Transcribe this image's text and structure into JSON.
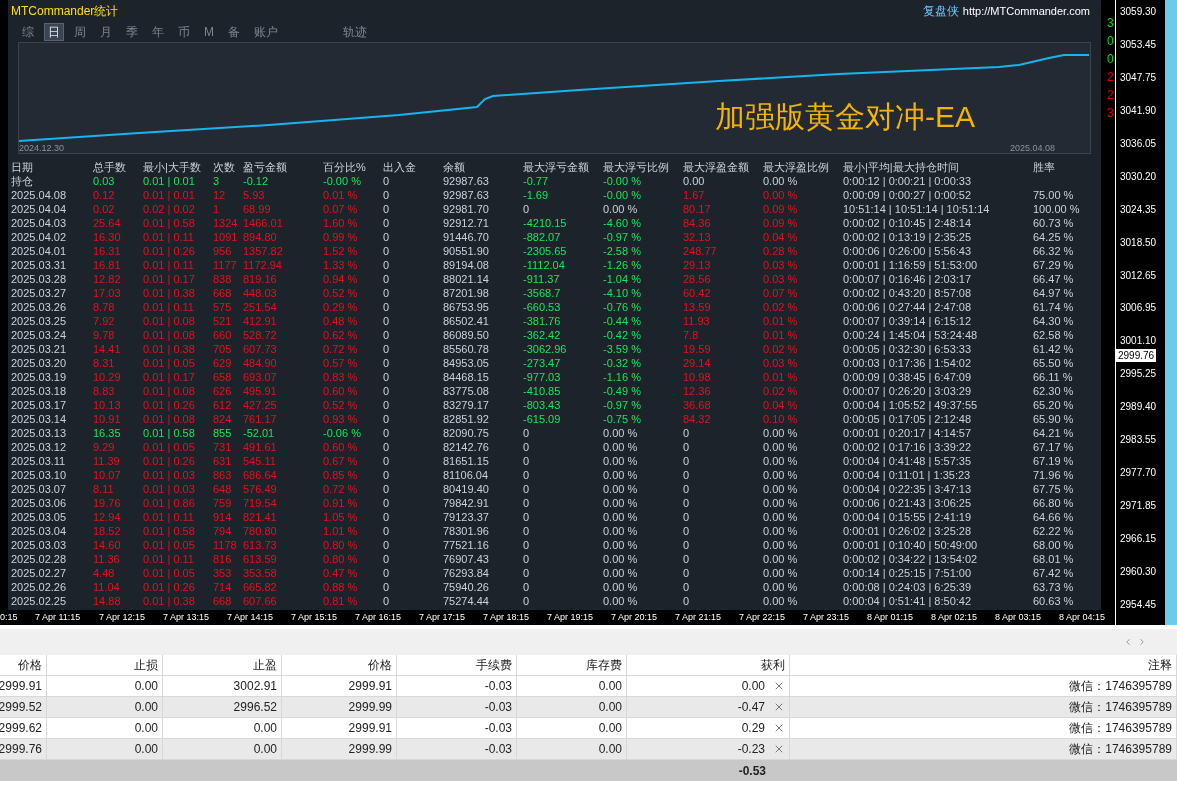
{
  "panel": {
    "title": "MTCommander统计",
    "brand": "复盘侠",
    "link": "http://MTCommander.com",
    "tabs": [
      {
        "label": "综",
        "selected": false
      },
      {
        "label": "日",
        "selected": true
      },
      {
        "label": "周",
        "selected": false
      },
      {
        "label": "月",
        "selected": false
      },
      {
        "label": "季",
        "selected": false
      },
      {
        "label": "年",
        "selected": false
      },
      {
        "label": "币",
        "selected": false
      },
      {
        "label": "M",
        "selected": false
      },
      {
        "label": "备",
        "selected": false
      },
      {
        "label": "账户",
        "selected": false
      }
    ],
    "trail_tab": {
      "label": "轨迹",
      "selected": false
    },
    "equity_chart": {
      "heading": "加强版黄金对冲-EA",
      "start_date": "2024.12.30",
      "end_date": "2025.04.08"
    },
    "stats_table": {
      "columns": [
        "日期",
        "总手数",
        "最小|大手数",
        "次数",
        "盈亏金额",
        "百分比%",
        "出入金",
        "余额",
        "最大浮亏金额",
        "最大浮亏比例",
        "最大浮盈金额",
        "最大浮盈比例",
        "最小|平均|最大持仓时间",
        "胜率"
      ],
      "rows": [
        {
          "profitable": false,
          "loss_marked": true,
          "gain_marked": false,
          "cells": [
            "持仓",
            "0.03",
            "0.01 | 0.01",
            "3",
            "-0.12",
            "-0.00 %",
            "0",
            "92987.63",
            "-0.77",
            "-0.00 %",
            "0.00",
            "0.00 %",
            "0:00:12 | 0:00:21 | 0:00:33"
          ]
        },
        {
          "profitable": true,
          "loss_marked": true,
          "gain_marked": true,
          "cells": [
            "2025.04.08",
            "0.12",
            "0.01 | 0.01",
            "12",
            "5.93",
            "0.01 %",
            "0",
            "92987.63",
            "-1.69",
            "-0.00 %",
            "1.67",
            "0.00 %",
            "0:00:09 | 0:00:27 | 0:00:52",
            "75.00 %"
          ]
        },
        {
          "profitable": true,
          "loss_marked": false,
          "gain_marked": true,
          "cells": [
            "2025.04.04",
            "0.02",
            "0.02 | 0.02",
            "1",
            "68.99",
            "0.07 %",
            "0",
            "92981.70",
            "0",
            "0.00 %",
            "80.17",
            "0.09 %",
            "10:51:14 | 10:51:14 | 10:51:14",
            "100.00 %"
          ]
        },
        {
          "profitable": true,
          "loss_marked": true,
          "gain_marked": true,
          "cells": [
            "2025.04.03",
            "25.64",
            "0.01 | 0.58",
            "1324",
            "1466.01",
            "1.60 %",
            "0",
            "92912.71",
            "-4210.15",
            "-4.60 %",
            "84.36",
            "0.09 %",
            "0:00:02 | 0:10:45 | 2:48:14",
            "60.73 %"
          ]
        },
        {
          "profitable": true,
          "loss_marked": true,
          "gain_marked": true,
          "cells": [
            "2025.04.02",
            "16.30",
            "0.01 | 0.11",
            "1091",
            "894.80",
            "0.99 %",
            "0",
            "91446.70",
            "-882.07",
            "-0.97 %",
            "32.13",
            "0.04 %",
            "0:00:02 | 0:13:19 | 2:35:25",
            "64.25 %"
          ]
        },
        {
          "profitable": true,
          "loss_marked": true,
          "gain_marked": true,
          "cells": [
            "2025.04.01",
            "16.31",
            "0.01 | 0.26",
            "956",
            "1357.82",
            "1.52 %",
            "0",
            "90551.90",
            "-2305.65",
            "-2.58 %",
            "248.77",
            "0.28 %",
            "0:00:06 | 0:26:00 | 5:56:43",
            "66.32 %"
          ]
        },
        {
          "profitable": true,
          "loss_marked": true,
          "gain_marked": true,
          "cells": [
            "2025.03.31",
            "16.81",
            "0.01 | 0.11",
            "1177",
            "1172.94",
            "1.33 %",
            "0",
            "89194.08",
            "-1112.04",
            "-1.26 %",
            "29.13",
            "0.03 %",
            "0:00:01 | 1:16:59 | 51:53:00",
            "67.29 %"
          ]
        },
        {
          "profitable": true,
          "loss_marked": true,
          "gain_marked": true,
          "cells": [
            "2025.03.28",
            "12.82",
            "0.01 | 0.17",
            "838",
            "819.16",
            "0.94 %",
            "0",
            "88021.14",
            "-911.37",
            "-1.04 %",
            "28.56",
            "0.03 %",
            "0:00:07 | 0:16:46 | 2:03:17",
            "66.47 %"
          ]
        },
        {
          "profitable": true,
          "loss_marked": true,
          "gain_marked": true,
          "cells": [
            "2025.03.27",
            "17.03",
            "0.01 | 0.38",
            "668",
            "448.03",
            "0.52 %",
            "0",
            "87201.98",
            "-3568.7",
            "-4.10 %",
            "60.42",
            "0.07 %",
            "0:00:02 | 0:43:20 | 8:57:08",
            "64.97 %"
          ]
        },
        {
          "profitable": true,
          "loss_marked": true,
          "gain_marked": true,
          "cells": [
            "2025.03.26",
            "8.78",
            "0.01 | 0.11",
            "575",
            "251.54",
            "0.29 %",
            "0",
            "86753.95",
            "-660.53",
            "-0.76 %",
            "13.59",
            "0.02 %",
            "0:00:06 | 0:27:44 | 2:47:08",
            "61.74 %"
          ]
        },
        {
          "profitable": true,
          "loss_marked": true,
          "gain_marked": true,
          "cells": [
            "2025.03.25",
            "7.92",
            "0.01 | 0.08",
            "521",
            "412.91",
            "0.48 %",
            "0",
            "86502.41",
            "-381.76",
            "-0.44 %",
            "11.93",
            "0.01 %",
            "0:00:07 | 0:39:14 | 6:15:12",
            "64.30 %"
          ]
        },
        {
          "profitable": true,
          "loss_marked": true,
          "gain_marked": true,
          "cells": [
            "2025.03.24",
            "9.78",
            "0.01 | 0.08",
            "660",
            "528.72",
            "0.62 %",
            "0",
            "86089.50",
            "-362.42",
            "-0.42 %",
            "7.8",
            "0.01 %",
            "0:00:24 | 1:45:04 | 53:24:48",
            "62.58 %"
          ]
        },
        {
          "profitable": true,
          "loss_marked": true,
          "gain_marked": true,
          "cells": [
            "2025.03.21",
            "14.41",
            "0.01 | 0.38",
            "705",
            "607.73",
            "0.72 %",
            "0",
            "85560.78",
            "-3062.96",
            "-3.59 %",
            "19.59",
            "0.02 %",
            "0:00:05 | 0:32:30 | 6:53:33",
            "61.42 %"
          ]
        },
        {
          "profitable": true,
          "loss_marked": true,
          "gain_marked": true,
          "cells": [
            "2025.03.20",
            "8.31",
            "0.01 | 0.05",
            "629",
            "484.90",
            "0.57 %",
            "0",
            "84953.05",
            "-273.47",
            "-0.32 %",
            "29.14",
            "0.03 %",
            "0:00:03 | 0:17:36 | 1:54:02",
            "65.50 %"
          ]
        },
        {
          "profitable": true,
          "loss_marked": true,
          "gain_marked": true,
          "cells": [
            "2025.03.19",
            "10.29",
            "0.01 | 0.17",
            "658",
            "693.07",
            "0.83 %",
            "0",
            "84468.15",
            "-977.03",
            "-1.16 %",
            "10.98",
            "0.01 %",
            "0:00:09 | 0:38:45 | 6:47:09",
            "66.11 %"
          ]
        },
        {
          "profitable": true,
          "loss_marked": true,
          "gain_marked": true,
          "cells": [
            "2025.03.18",
            "8.83",
            "0.01 | 0.08",
            "626",
            "495.91",
            "0.60 %",
            "0",
            "83775.08",
            "-410.85",
            "-0.49 %",
            "12.36",
            "0.02 %",
            "0:00:07 | 0:26:20 | 3:03:29",
            "62.30 %"
          ]
        },
        {
          "profitable": true,
          "loss_marked": true,
          "gain_marked": true,
          "cells": [
            "2025.03.17",
            "10.13",
            "0.01 | 0.26",
            "612",
            "427.25",
            "0.52 %",
            "0",
            "83279.17",
            "-803.43",
            "-0.97 %",
            "36.68",
            "0.04 %",
            "0:00:04 | 1:05:52 | 49:37:55",
            "65.20 %"
          ]
        },
        {
          "profitable": true,
          "loss_marked": true,
          "gain_marked": true,
          "cells": [
            "2025.03.14",
            "10.91",
            "0.01 | 0.08",
            "824",
            "761.17",
            "0.93 %",
            "0",
            "82851.92",
            "-615.09",
            "-0.75 %",
            "84.32",
            "0.10 %",
            "0:00:05 | 0:17:05 | 2:12:48",
            "65.90 %"
          ]
        },
        {
          "profitable": false,
          "loss_marked": false,
          "gain_marked": false,
          "cells": [
            "2025.03.13",
            "16.35",
            "0.01 | 0.58",
            "855",
            "-52.01",
            "-0.06 %",
            "0",
            "82090.75",
            "0",
            "0.00 %",
            "0",
            "0.00 %",
            "0:00:01 | 0:20:17 | 4:14:57",
            "64.21 %"
          ]
        },
        {
          "profitable": true,
          "loss_marked": false,
          "gain_marked": false,
          "cells": [
            "2025.03.12",
            "9.29",
            "0.01 | 0.05",
            "731",
            "491.61",
            "0.60 %",
            "0",
            "82142.76",
            "0",
            "0.00 %",
            "0",
            "0.00 %",
            "0:00:02 | 0:17:16 | 3:39:22",
            "67.17 %"
          ]
        },
        {
          "profitable": true,
          "loss_marked": false,
          "gain_marked": false,
          "cells": [
            "2025.03.11",
            "11.39",
            "0.01 | 0.26",
            "631",
            "545.11",
            "0.67 %",
            "0",
            "81651.15",
            "0",
            "0.00 %",
            "0",
            "0.00 %",
            "0:00:04 | 0:41:48 | 5:57:35",
            "67.19 %"
          ]
        },
        {
          "profitable": true,
          "loss_marked": false,
          "gain_marked": false,
          "cells": [
            "2025.03.10",
            "10.07",
            "0.01 | 0.03",
            "863",
            "686.64",
            "0.85 %",
            "0",
            "81106.04",
            "0",
            "0.00 %",
            "0",
            "0.00 %",
            "0:00:04 | 0:11:01 | 1:35:23",
            "71.96 %"
          ]
        },
        {
          "profitable": true,
          "loss_marked": false,
          "gain_marked": false,
          "cells": [
            "2025.03.07",
            "8.11",
            "0.01 | 0.03",
            "648",
            "576.49",
            "0.72 %",
            "0",
            "80419.40",
            "0",
            "0.00 %",
            "0",
            "0.00 %",
            "0:00:04 | 0:22:35 | 3:47:13",
            "67.75 %"
          ]
        },
        {
          "profitable": true,
          "loss_marked": false,
          "gain_marked": false,
          "cells": [
            "2025.03.06",
            "19.76",
            "0.01 | 0.86",
            "759",
            "719.54",
            "0.91 %",
            "0",
            "79842.91",
            "0",
            "0.00 %",
            "0",
            "0.00 %",
            "0:00:06 | 0:21:43 | 3:06:25",
            "66.80 %"
          ]
        },
        {
          "profitable": true,
          "loss_marked": false,
          "gain_marked": false,
          "cells": [
            "2025.03.05",
            "12.94",
            "0.01 | 0.11",
            "914",
            "821.41",
            "1.05 %",
            "0",
            "79123.37",
            "0",
            "0.00 %",
            "0",
            "0.00 %",
            "0:00:04 | 0:15:55 | 2:41:19",
            "64.66 %"
          ]
        },
        {
          "profitable": true,
          "loss_marked": false,
          "gain_marked": false,
          "cells": [
            "2025.03.04",
            "18.52",
            "0.01 | 0.58",
            "794",
            "780.80",
            "1.01 %",
            "0",
            "78301.96",
            "0",
            "0.00 %",
            "0",
            "0.00 %",
            "0:00:01 | 0:26:02 | 3:25:28",
            "62.22 %"
          ]
        },
        {
          "profitable": true,
          "loss_marked": false,
          "gain_marked": false,
          "cells": [
            "2025.03.03",
            "14.60",
            "0.01 | 0.05",
            "1178",
            "613.73",
            "0.80 %",
            "0",
            "77521.16",
            "0",
            "0.00 %",
            "0",
            "0.00 %",
            "0:00:01 | 0:10:40 | 50:49:00",
            "68.00 %"
          ]
        },
        {
          "profitable": true,
          "loss_marked": false,
          "gain_marked": false,
          "cells": [
            "2025.02.28",
            "11.36",
            "0.01 | 0.11",
            "816",
            "613.59",
            "0.80 %",
            "0",
            "76907.43",
            "0",
            "0.00 %",
            "0",
            "0.00 %",
            "0:00:02 | 0:34:22 | 13:54:02",
            "68.01 %"
          ]
        },
        {
          "profitable": true,
          "loss_marked": false,
          "gain_marked": false,
          "cells": [
            "2025.02.27",
            "4.48",
            "0.01 | 0.05",
            "353",
            "353.58",
            "0.47 %",
            "0",
            "76293.84",
            "0",
            "0.00 %",
            "0",
            "0.00 %",
            "0:00:14 | 0:25:15 | 7:51:00",
            "67.42 %"
          ]
        },
        {
          "profitable": true,
          "loss_marked": false,
          "gain_marked": false,
          "cells": [
            "2025.02.26",
            "11.04",
            "0.01 | 0.26",
            "714",
            "665.82",
            "0.88 %",
            "0",
            "75940.26",
            "0",
            "0.00 %",
            "0",
            "0.00 %",
            "0:00:08 | 0:24:03 | 6:25:39",
            "63.73 %"
          ]
        },
        {
          "profitable": true,
          "loss_marked": false,
          "gain_marked": false,
          "cells": [
            "2025.02.25",
            "14.88",
            "0.01 | 0.38",
            "668",
            "607.66",
            "0.81 %",
            "0",
            "75274.44",
            "0",
            "0.00 %",
            "0",
            "0.00 %",
            "0:00:04 | 0:51:41 | 8:50:42",
            "60.63 %"
          ]
        }
      ]
    }
  },
  "side_counters": [
    {
      "label": "3",
      "color": "#00e000"
    },
    {
      "label": "0",
      "color": "#00e000"
    },
    {
      "label": "0",
      "color": "#00e000"
    },
    {
      "label": "2",
      "color": "#e00000"
    },
    {
      "label": "2",
      "color": "#e00000"
    },
    {
      "label": "3",
      "color": "#e00000"
    }
  ],
  "price_axis": {
    "labels": [
      "3059.30",
      "3053.45",
      "3047.75",
      "3041.90",
      "3036.05",
      "3030.20",
      "3024.35",
      "3018.50",
      "3012.65",
      "3006.95",
      "3001.10",
      "2995.25",
      "2989.40",
      "2983.55",
      "2977.70",
      "2971.85",
      "2966.15",
      "2960.30",
      "2954.45"
    ],
    "current_price": "2999.76"
  },
  "time_axis": [
    "0:15",
    "7 Apr 11:15",
    "7 Apr 12:15",
    "7 Apr 13:15",
    "7 Apr 14:15",
    "7 Apr 15:15",
    "7 Apr 16:15",
    "7 Apr 17:15",
    "7 Apr 18:15",
    "7 Apr 19:15",
    "7 Apr 20:15",
    "7 Apr 21:15",
    "7 Apr 22:15",
    "7 Apr 23:15",
    "8 Apr 01:15",
    "8 Apr 02:15",
    "8 Apr 03:15",
    "8 Apr 04:15"
  ],
  "trade_table": {
    "columns": [
      "价格",
      "止损",
      "止盈",
      "价格",
      "手续费",
      "库存费",
      "获利",
      "注释"
    ],
    "rows": [
      {
        "cells": [
          "2999.91",
          "0.00",
          "3002.91",
          "2999.91",
          "-0.03",
          "0.00",
          "0.00",
          "微信：1746395789"
        ]
      },
      {
        "cells": [
          "2999.52",
          "0.00",
          "2996.52",
          "2999.99",
          "-0.03",
          "0.00",
          "-0.47",
          "微信：1746395789"
        ]
      },
      {
        "cells": [
          "2999.62",
          "0.00",
          "0.00",
          "2999.91",
          "-0.03",
          "0.00",
          "0.29",
          "微信：1746395789"
        ]
      },
      {
        "cells": [
          "2999.76",
          "0.00",
          "0.00",
          "2999.99",
          "-0.03",
          "0.00",
          "-0.23",
          "微信：1746395789"
        ]
      }
    ],
    "total_profit": "-0.53"
  }
}
